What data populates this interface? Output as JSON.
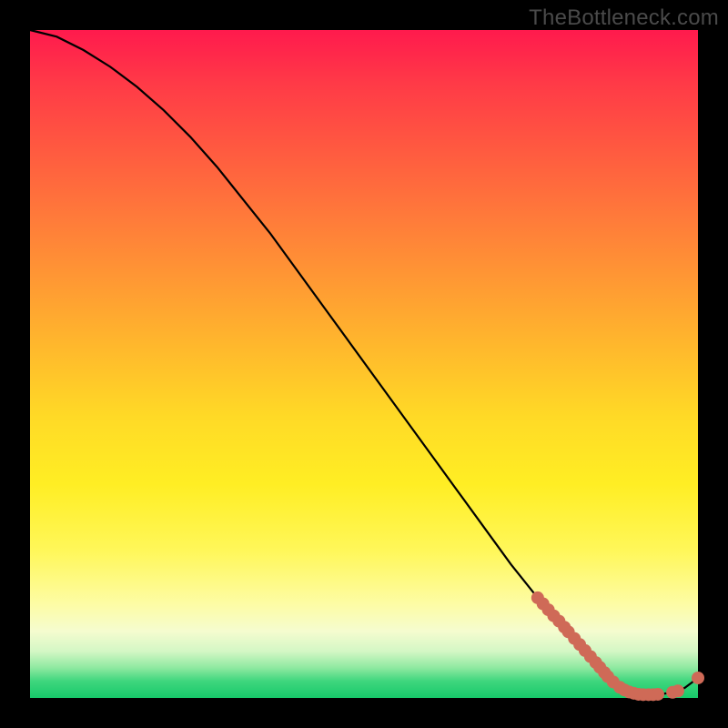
{
  "watermark": "TheBottleneck.com",
  "colors": {
    "curve": "#000000",
    "dot_fill": "#cf6a57",
    "dot_stroke": "#b25545"
  },
  "chart_data": {
    "type": "line",
    "title": "",
    "xlabel": "",
    "ylabel": "",
    "xlim": [
      0,
      100
    ],
    "ylim": [
      0,
      100
    ],
    "series": [
      {
        "name": "curve",
        "x": [
          0,
          4,
          8,
          12,
          16,
          20,
          24,
          28,
          32,
          36,
          40,
          44,
          48,
          52,
          56,
          60,
          64,
          68,
          72,
          76,
          80,
          84,
          86,
          88,
          90,
          92,
          94,
          96,
          98,
          100
        ],
        "y": [
          100,
          99,
          97,
          94.5,
          91.5,
          88,
          84,
          79.5,
          74.5,
          69.5,
          64,
          58.5,
          53,
          47.5,
          42,
          36.5,
          31,
          25.5,
          20,
          15,
          10,
          5.5,
          3.5,
          2,
          1,
          0.5,
          0.5,
          0.8,
          1.5,
          3
        ]
      }
    ],
    "points": [
      {
        "x": 76.0,
        "y": 15.0
      },
      {
        "x": 76.8,
        "y": 14.1
      },
      {
        "x": 77.6,
        "y": 13.2
      },
      {
        "x": 78.4,
        "y": 12.3
      },
      {
        "x": 79.2,
        "y": 11.5
      },
      {
        "x": 80.0,
        "y": 10.6
      },
      {
        "x": 80.6,
        "y": 9.9
      },
      {
        "x": 81.5,
        "y": 8.9
      },
      {
        "x": 82.3,
        "y": 8.0
      },
      {
        "x": 83.1,
        "y": 7.1
      },
      {
        "x": 83.9,
        "y": 6.2
      },
      {
        "x": 84.7,
        "y": 5.3
      },
      {
        "x": 85.3,
        "y": 4.6
      },
      {
        "x": 86.0,
        "y": 3.8
      },
      {
        "x": 86.5,
        "y": 3.2
      },
      {
        "x": 87.3,
        "y": 2.4
      },
      {
        "x": 88.3,
        "y": 1.6
      },
      {
        "x": 89.0,
        "y": 1.2
      },
      {
        "x": 89.7,
        "y": 0.9
      },
      {
        "x": 90.4,
        "y": 0.7
      },
      {
        "x": 91.1,
        "y": 0.55
      },
      {
        "x": 91.8,
        "y": 0.5
      },
      {
        "x": 92.6,
        "y": 0.5
      },
      {
        "x": 93.3,
        "y": 0.5
      },
      {
        "x": 94.0,
        "y": 0.55
      },
      {
        "x": 96.2,
        "y": 0.85
      },
      {
        "x": 97.0,
        "y": 1.05
      },
      {
        "x": 100.0,
        "y": 3.0
      }
    ]
  }
}
